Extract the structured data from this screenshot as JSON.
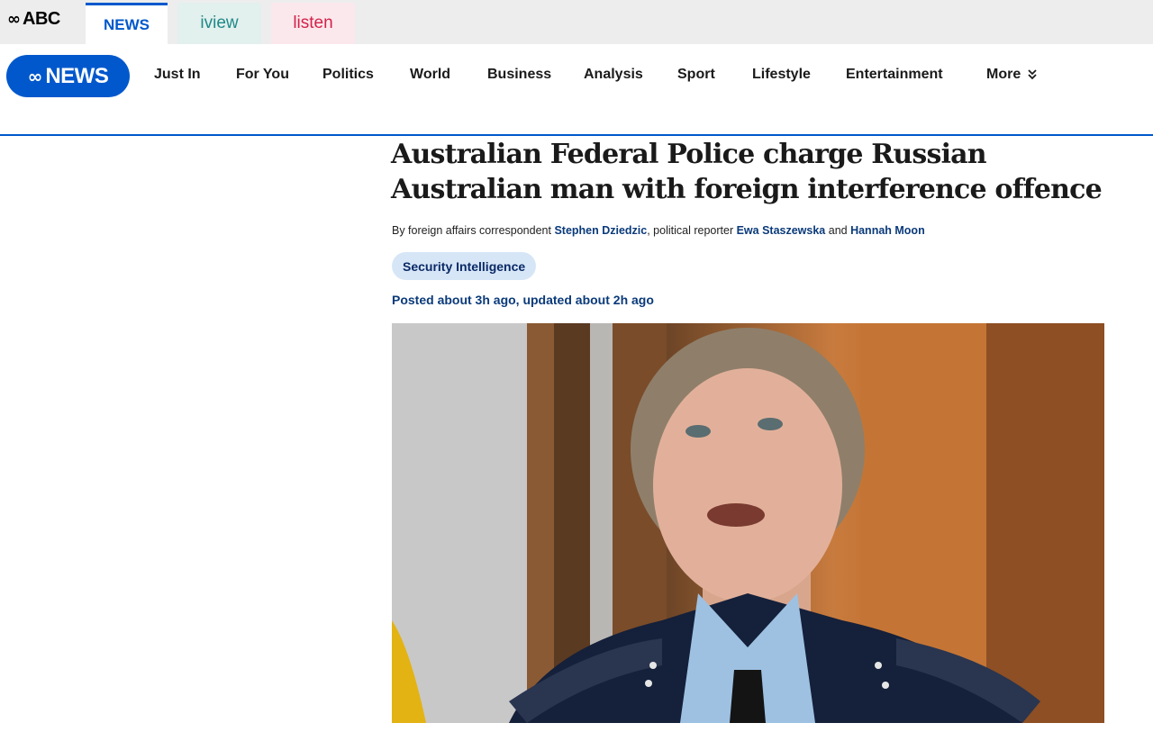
{
  "network": {
    "abc_logo_text": "ABC",
    "tabs": [
      {
        "label": "NEWS"
      },
      {
        "label": "iview"
      },
      {
        "label": "listen"
      }
    ]
  },
  "nav": {
    "logo_text": "NEWS",
    "items": [
      {
        "label": "Just In"
      },
      {
        "label": "For You"
      },
      {
        "label": "Politics"
      },
      {
        "label": "World"
      },
      {
        "label": "Business"
      },
      {
        "label": "Analysis"
      },
      {
        "label": "Sport"
      },
      {
        "label": "Lifestyle"
      },
      {
        "label": "Entertainment"
      },
      {
        "label": "More"
      }
    ],
    "more_icon": "double-chevron-down-icon"
  },
  "article": {
    "headline": "Australian Federal Police charge Russian Australian man with foreign interference offence",
    "byline": {
      "prefix": "By foreign affairs correspondent ",
      "author1": "Stephen Dziedzic",
      "mid": ", political reporter ",
      "author2": "Ewa Staszewska",
      "and": " and ",
      "author3": "Hannah Moon"
    },
    "topic": "Security Intelligence",
    "timestamp": "Posted about 3h ago, updated about 2h ago"
  },
  "colors": {
    "brand_blue": "#0058cc",
    "iview_teal": "#1f8a88",
    "listen_pink": "#d3224a",
    "pill_bg": "#d7e6f7"
  }
}
